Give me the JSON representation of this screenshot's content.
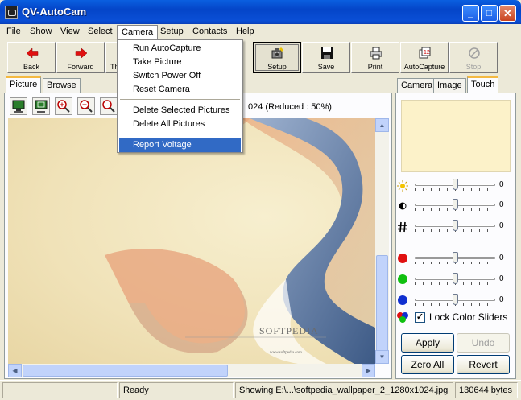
{
  "window": {
    "title": "QV-AutoCam"
  },
  "menubar": [
    "File",
    "Show",
    "View",
    "Select",
    "Camera",
    "Setup",
    "Contacts",
    "Help"
  ],
  "toolbar": {
    "back": "Back",
    "forward": "Forward",
    "thumbs": "Th",
    "setup": "Setup",
    "save": "Save",
    "print": "Print",
    "autocapture": "AutoCapture",
    "stop": "Stop"
  },
  "left_tabs": [
    "Picture",
    "Browse"
  ],
  "image_info": "024  (Reduced : 50%)",
  "image_caption": {
    "brand": "SOFTPEDIA",
    "url": "www.softpedia.com"
  },
  "right_tabs": [
    "Camera",
    "Image",
    "Touch"
  ],
  "sliders": {
    "brightness": "0",
    "contrast": "0",
    "sharpness": "0",
    "red": "0",
    "green": "0",
    "blue": "0"
  },
  "lock_label": "Lock Color Sliders",
  "buttons": {
    "apply": "Apply",
    "undo": "Undo",
    "zero_all": "Zero All",
    "revert": "Revert"
  },
  "status": {
    "ready": "Ready",
    "showing": "Showing E:\\...\\softpedia_wallpaper_2_1280x1024.jpg",
    "size": "130644 bytes"
  },
  "camera_menu": {
    "items": [
      "Run AutoCapture",
      "Take Picture",
      "Switch Power Off",
      "Reset Camera",
      "Delete Selected Pictures",
      "Delete All Pictures",
      "Report Voltage"
    ]
  },
  "colors": {
    "titlebar": "#0445c8",
    "menu_highlight": "#316ac5",
    "image_bg": "#f0e2b8"
  }
}
